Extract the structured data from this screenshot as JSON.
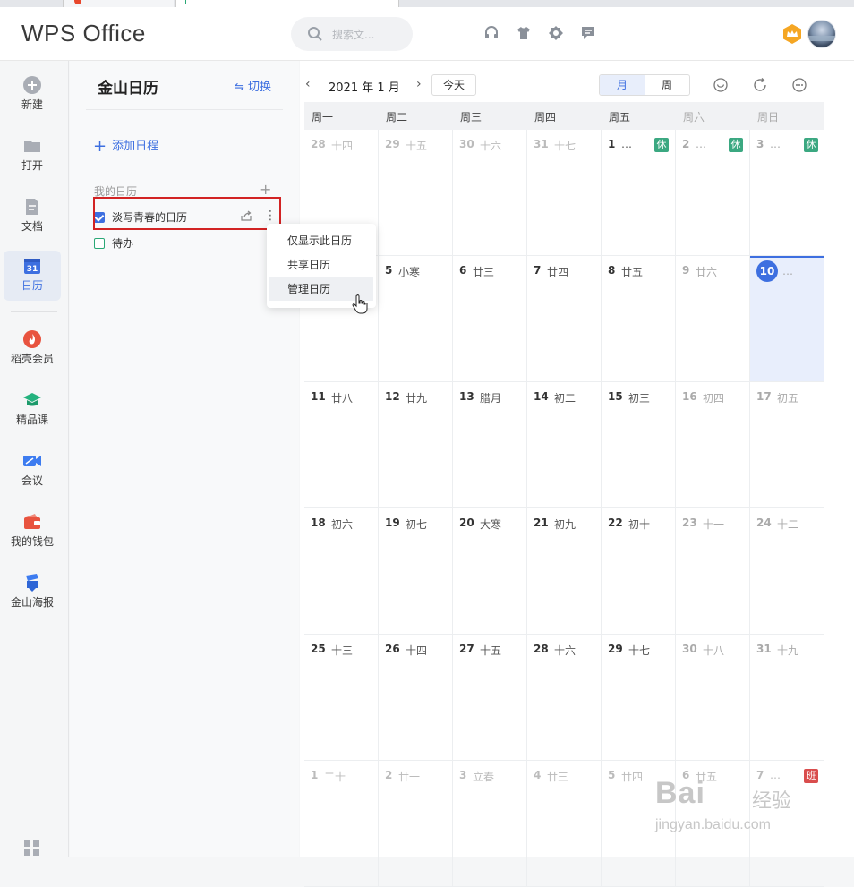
{
  "app": {
    "title": "WPS Office"
  },
  "header": {
    "search_placeholder": "搜索文..."
  },
  "nav": {
    "items": [
      {
        "label": "新建"
      },
      {
        "label": "打开"
      },
      {
        "label": "文档"
      },
      {
        "label": "日历"
      },
      {
        "label": "稻壳会员"
      },
      {
        "label": "精品课"
      },
      {
        "label": "会议"
      },
      {
        "label": "我的钱包"
      },
      {
        "label": "金山海报"
      }
    ],
    "calendar_icon_text": "31"
  },
  "sidepanel": {
    "title": "金山日历",
    "switch_label": "⇋ 切换",
    "add_label": "添加日程",
    "section_title": "我的日历",
    "calendars": [
      {
        "name": "淡写青春的日历",
        "checked": true
      },
      {
        "name": "待办",
        "checked": false
      }
    ]
  },
  "context_menu": {
    "items": [
      "仅显示此日历",
      "共享日历",
      "管理日历"
    ],
    "hovered": "管理日历"
  },
  "toolbar": {
    "prev": "‹",
    "date": "2021 年 1 月",
    "next": "›",
    "today": "今天",
    "views": [
      "月",
      "周"
    ],
    "active_view": "月"
  },
  "weekdays": [
    "周一",
    "周二",
    "周三",
    "周四",
    "周五",
    "周六",
    "周日"
  ],
  "weeks": [
    [
      {
        "d": "28",
        "l": "十四",
        "muted": true
      },
      {
        "d": "29",
        "l": "十五",
        "muted": true
      },
      {
        "d": "30",
        "l": "十六",
        "muted": true
      },
      {
        "d": "31",
        "l": "十七",
        "muted": true
      },
      {
        "d": "1",
        "l": "…",
        "badge": "休"
      },
      {
        "d": "2",
        "l": "…",
        "badge": "休"
      },
      {
        "d": "3",
        "l": "…",
        "badge": "休"
      }
    ],
    [
      {
        "d": "",
        "l": ""
      },
      {
        "d": "5",
        "l": "小寒"
      },
      {
        "d": "6",
        "l": "廿三"
      },
      {
        "d": "7",
        "l": "廿四"
      },
      {
        "d": "8",
        "l": "廿五"
      },
      {
        "d": "9",
        "l": "廿六"
      },
      {
        "d": "10",
        "l": "…",
        "today": true
      }
    ],
    [
      {
        "d": "11",
        "l": "廿八"
      },
      {
        "d": "12",
        "l": "廿九"
      },
      {
        "d": "13",
        "l": "腊月"
      },
      {
        "d": "14",
        "l": "初二"
      },
      {
        "d": "15",
        "l": "初三"
      },
      {
        "d": "16",
        "l": "初四"
      },
      {
        "d": "17",
        "l": "初五"
      }
    ],
    [
      {
        "d": "18",
        "l": "初六"
      },
      {
        "d": "19",
        "l": "初七"
      },
      {
        "d": "20",
        "l": "大寒"
      },
      {
        "d": "21",
        "l": "初九"
      },
      {
        "d": "22",
        "l": "初十"
      },
      {
        "d": "23",
        "l": "十一"
      },
      {
        "d": "24",
        "l": "十二"
      }
    ],
    [
      {
        "d": "25",
        "l": "十三"
      },
      {
        "d": "26",
        "l": "十四"
      },
      {
        "d": "27",
        "l": "十五"
      },
      {
        "d": "28",
        "l": "十六"
      },
      {
        "d": "29",
        "l": "十七"
      },
      {
        "d": "30",
        "l": "十八"
      },
      {
        "d": "31",
        "l": "十九"
      }
    ],
    [
      {
        "d": "1",
        "l": "二十",
        "muted": true
      },
      {
        "d": "2",
        "l": "廿一",
        "muted": true
      },
      {
        "d": "3",
        "l": "立春",
        "muted": true
      },
      {
        "d": "4",
        "l": "廿三",
        "muted": true
      },
      {
        "d": "5",
        "l": "廿四",
        "muted": true
      },
      {
        "d": "6",
        "l": "廿五",
        "muted": true
      },
      {
        "d": "7",
        "l": "…",
        "muted": true,
        "badge": "班",
        "work": true
      }
    ]
  ],
  "watermark": {
    "line1": "Bai",
    "line2": "经验",
    "line3": "jingyan.baidu.com"
  },
  "colors": {
    "accent": "#3d6fe0",
    "rest_badge": "#3ba881",
    "work_badge": "#d94d4d",
    "highlight_box": "#d22323"
  }
}
